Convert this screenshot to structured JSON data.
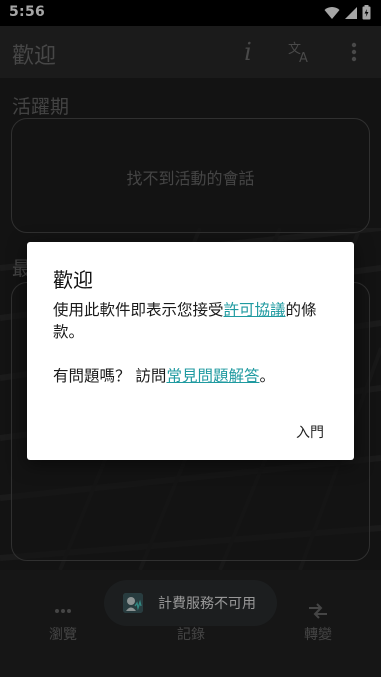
{
  "status_bar": {
    "time": "5:56",
    "icons": [
      "wifi-icon",
      "signal-icon",
      "battery-icon"
    ]
  },
  "app_bar": {
    "title": "歡迎",
    "actions": [
      "info-icon",
      "translate-icon",
      "more-vert-icon"
    ]
  },
  "content": {
    "active_label": "活躍期",
    "active_empty": "找不到活動的會話",
    "recent_label_partial": "最"
  },
  "bottom_nav": {
    "items": [
      {
        "label": "瀏覽",
        "icon": "more-horiz-icon"
      },
      {
        "label": "記錄",
        "icon": "history-icon"
      },
      {
        "label": "轉變",
        "icon": "convert-icon"
      }
    ]
  },
  "toast": {
    "text": "計費服務不可用",
    "icon": "app-icon"
  },
  "dialog": {
    "title": "歡迎",
    "line1_prefix": "使用此軟件即表示您接受",
    "license_link": "許可協議",
    "line1_suffix": "的條款。",
    "line2_prefix": "有問題嗎？ 訪問",
    "faq_link": "常見問題解答",
    "line2_suffix": "。",
    "button": "入門"
  },
  "colors": {
    "accent_link": "#1f9aa0",
    "dialog_bg": "#ffffff",
    "app_bar_bg": "#2a2a2a"
  }
}
